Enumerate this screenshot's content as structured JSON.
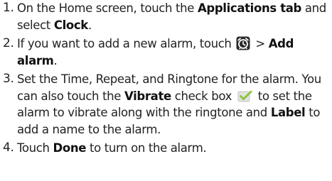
{
  "steps": [
    {
      "num": "1.",
      "t1": "On the Home screen, touch the ",
      "b1": "Applications tab",
      "t2": " and select ",
      "b2": "Clock",
      "t3": "."
    },
    {
      "num": "2.",
      "t1": "If you want to add a new alarm, touch ",
      "t2": " > ",
      "b1": "Add alarm",
      "t3": "."
    },
    {
      "num": "3.",
      "t1": "Set the Time, Repeat, and Ringtone for the alarm. You can also touch the ",
      "b1": "Vibrate",
      "t2": " check box ",
      "t3": " to set the alarm to vibrate along with the ringtone and ",
      "b2": "Label",
      "t4": " to add a name to the alarm."
    },
    {
      "num": "4.",
      "t1": "Touch ",
      "b1": "Done",
      "t2": " to turn on the alarm."
    }
  ],
  "icons": {
    "alarm": "alarm-clock-icon",
    "checkbox": "checkbox-checked-icon"
  },
  "colors": {
    "text": "#222222",
    "icon_bg": "#2b2b2b",
    "icon_fg": "#ffffff",
    "check_box": "#dcdcdc",
    "check_mark": "#8cc63f"
  }
}
